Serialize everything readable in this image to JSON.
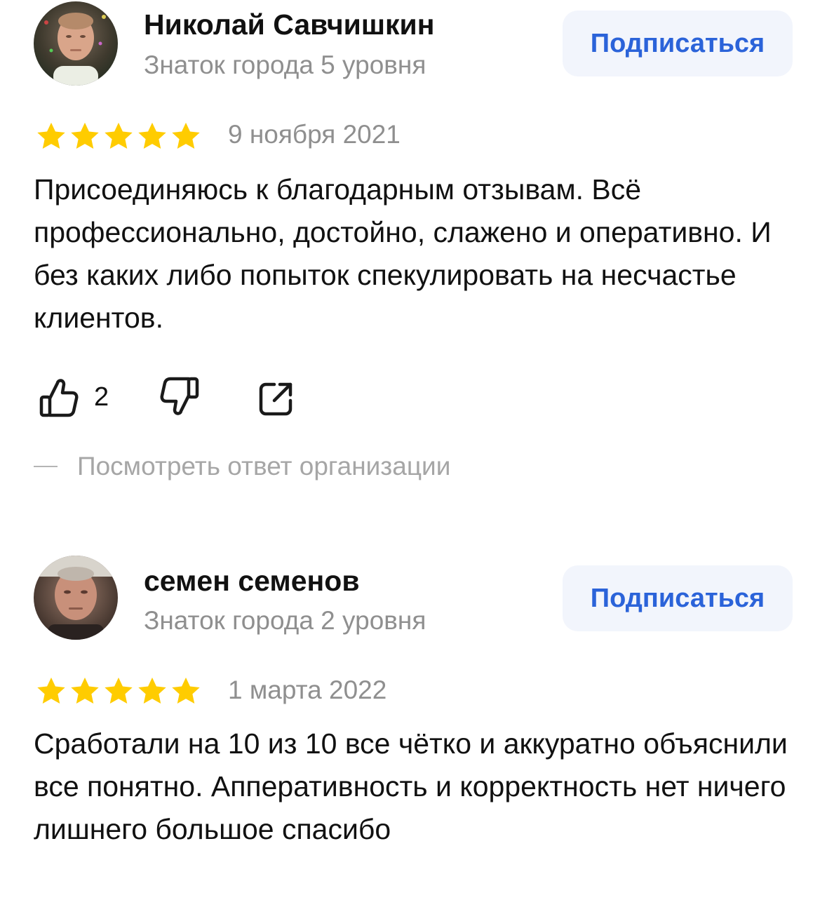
{
  "reviews": [
    {
      "author": {
        "name": "Николай Савчишкин",
        "level": "Знаток города 5 уровня",
        "avatar_icon": "user-photo"
      },
      "subscribe_label": "Подписаться",
      "rating": 5,
      "date": "9 ноября 2021",
      "text": "Присоединяюсь к благодарным отзывам. Всё профессионально, достойно, слажено и оперативно. И без каких либо попыток спекулировать на несчастье клиентов.",
      "likes": "2",
      "org_reply_link": "Посмотреть ответ организации"
    },
    {
      "author": {
        "name": "семен семенов",
        "level": "Знаток города 2 уровня",
        "avatar_icon": "user-photo"
      },
      "subscribe_label": "Подписаться",
      "rating": 5,
      "date": "1 марта 2022",
      "text": "Сработали на 10 из 10 все чётко и аккуратно объяснили все понятно. Апперативность и корректность нет ничего лишнего большое спасибо"
    }
  ],
  "colors": {
    "star": "#ffcc00",
    "accent": "#2b63d9",
    "button_bg": "#f2f5fc",
    "muted_text": "#8f8f8f"
  },
  "icons": {
    "like": "thumbs-up-icon",
    "dislike": "thumbs-down-icon",
    "share": "share-icon",
    "star": "star-icon"
  }
}
